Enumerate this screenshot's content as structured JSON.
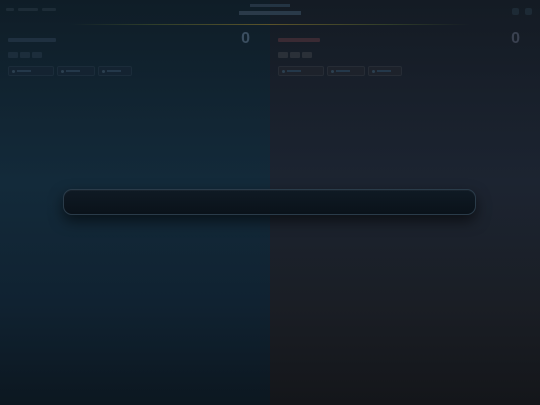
{
  "header": {
    "title_small": "",
    "title_main": ""
  },
  "left_team": {
    "score": "0",
    "score_sub": ""
  },
  "right_team": {
    "score": "0",
    "score_sub": ""
  },
  "overlay": {
    "label": ""
  }
}
